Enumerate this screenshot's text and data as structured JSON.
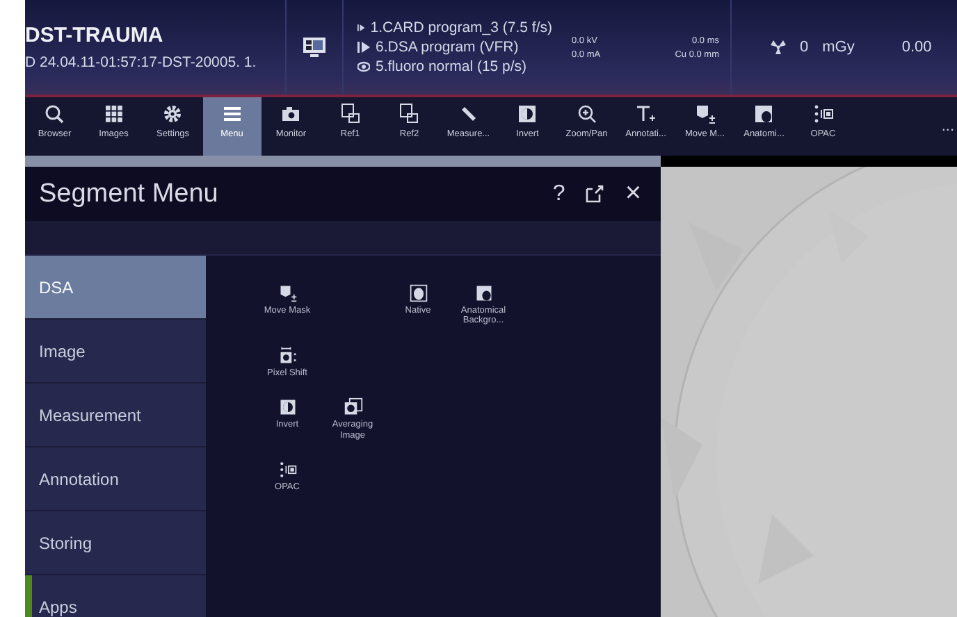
{
  "header": {
    "patient": "DST-TRAUMA",
    "study": "D 24.04.11-01:57:17-DST-20005. 1.",
    "programs": [
      {
        "kind": "play",
        "text": "1.CARD program_3 (7.5 f/s)"
      },
      {
        "kind": "play",
        "text": "6.DSA program (VFR)"
      },
      {
        "kind": "fluoro",
        "text": "5.fluoro normal (15 p/s)"
      }
    ],
    "kv": "0.0 kV",
    "ma": "0.0 mA",
    "ms": "0.0 ms",
    "cu": "Cu 0.0 mm",
    "dose_value": "0",
    "dose_unit": "mGy",
    "dose2": "0.00"
  },
  "toolbar": [
    {
      "kind": "search",
      "label": "Browser",
      "selected": false
    },
    {
      "kind": "grid",
      "label": "Images",
      "selected": false
    },
    {
      "kind": "gear",
      "label": "Settings",
      "selected": false
    },
    {
      "kind": "menu",
      "label": "Menu",
      "selected": true
    },
    {
      "kind": "camera",
      "label": "Monitor",
      "selected": false
    },
    {
      "kind": "ref",
      "label": "Ref1",
      "selected": false
    },
    {
      "kind": "ref",
      "label": "Ref2",
      "selected": false
    },
    {
      "kind": "ruler",
      "label": "Measure...",
      "selected": false
    },
    {
      "kind": "invert",
      "label": "Invert",
      "selected": false
    },
    {
      "kind": "zoom",
      "label": "Zoom/Pan",
      "selected": false
    },
    {
      "kind": "text",
      "label": "Annotati...",
      "selected": false
    },
    {
      "kind": "mask",
      "label": "Move M...",
      "selected": false
    },
    {
      "kind": "anatomy",
      "label": "Anatomi...",
      "selected": false
    },
    {
      "kind": "opac",
      "label": "OPAC",
      "selected": false
    }
  ],
  "toolbar_more": "...",
  "panel": {
    "title": "Segment Menu",
    "help": "?",
    "close": "×",
    "categories": [
      {
        "label": "DSA",
        "selected": true,
        "flagged": false
      },
      {
        "label": "Image",
        "selected": false,
        "flagged": false
      },
      {
        "label": "Measurement",
        "selected": false,
        "flagged": false
      },
      {
        "label": "Annotation",
        "selected": false,
        "flagged": false
      },
      {
        "label": "Storing",
        "selected": false,
        "flagged": false
      },
      {
        "label": "Apps",
        "selected": false,
        "flagged": true
      }
    ],
    "rows": [
      [
        {
          "kind": "mask",
          "label": "Move Mask"
        },
        {
          "kind": "none"
        },
        {
          "kind": "native",
          "label": "Native"
        },
        {
          "kind": "anatomy",
          "label": "Anatomical Backgro..."
        }
      ],
      [
        {
          "kind": "shift",
          "label": "Pixel Shift"
        }
      ],
      [
        {
          "kind": "invert",
          "label": "Invert"
        },
        {
          "kind": "average",
          "label": "Averaging Image"
        }
      ],
      [
        {
          "kind": "opac",
          "label": "OPAC"
        }
      ]
    ]
  }
}
